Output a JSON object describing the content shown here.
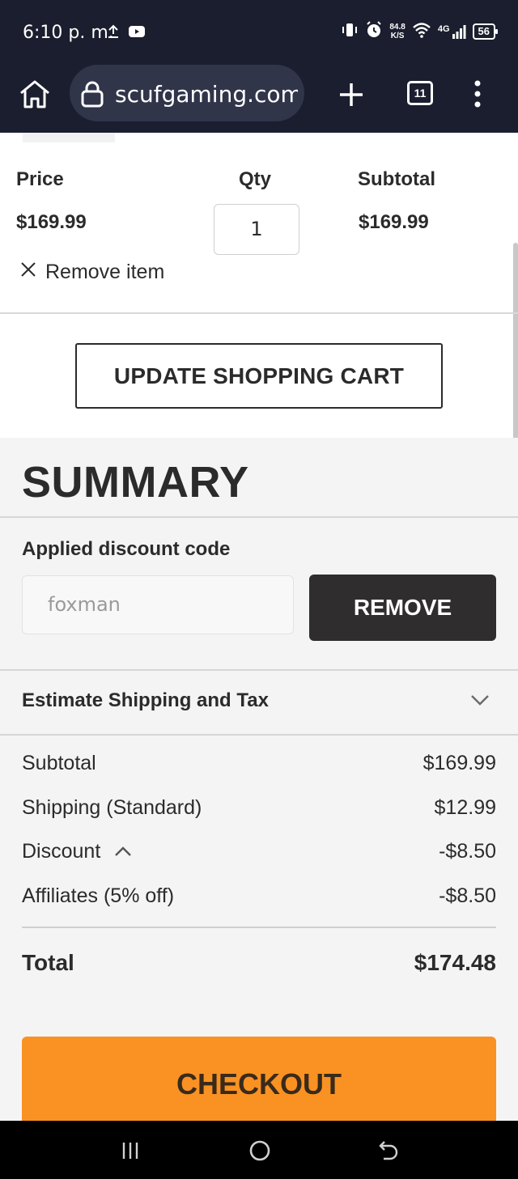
{
  "status_bar": {
    "time": "6:10 p. m.",
    "net_speed_value": "84.8",
    "net_speed_unit": "K/S",
    "network": "4G",
    "battery": "56"
  },
  "browser": {
    "url": "scufgaming.com/",
    "tab_count": "11"
  },
  "cart": {
    "price_header": "Price",
    "qty_header": "Qty",
    "subtotal_header": "Subtotal",
    "price": "$169.99",
    "qty": "1",
    "subtotal": "$169.99",
    "remove_item_label": "Remove item",
    "update_button": "UPDATE SHOPPING CART"
  },
  "summary": {
    "title": "SUMMARY",
    "discount_label": "Applied discount code",
    "discount_code": "foxman",
    "remove_button": "REMOVE",
    "estimate_label": "Estimate Shipping and Tax",
    "rows": [
      {
        "label": "Subtotal",
        "value": "$169.99"
      },
      {
        "label": "Shipping (Standard)",
        "value": "$12.99"
      },
      {
        "label": "Discount",
        "value": "-$8.50"
      },
      {
        "label": "Affiliates (5% off)",
        "value": "-$8.50"
      }
    ],
    "total_label": "Total",
    "total_value": "$174.48",
    "checkout_button": "CHECKOUT"
  },
  "colors": {
    "bar_dark": "#1b1e2e",
    "url_pill": "#31354a",
    "checkout": "#f99223",
    "remove_button": "#2f2d2e",
    "summary_bg": "#f4f4f4"
  },
  "icons": [
    "upload-icon",
    "youtube-icon",
    "vibrate-icon",
    "alarm-icon",
    "wifi-icon",
    "signal-icon",
    "battery-icon",
    "home-icon",
    "lock-icon",
    "plus-icon",
    "tabs-icon",
    "more-vert-icon",
    "close-icon",
    "chevron-down-icon",
    "chevron-up-icon",
    "recents-icon",
    "home-circle-icon",
    "back-icon"
  ]
}
